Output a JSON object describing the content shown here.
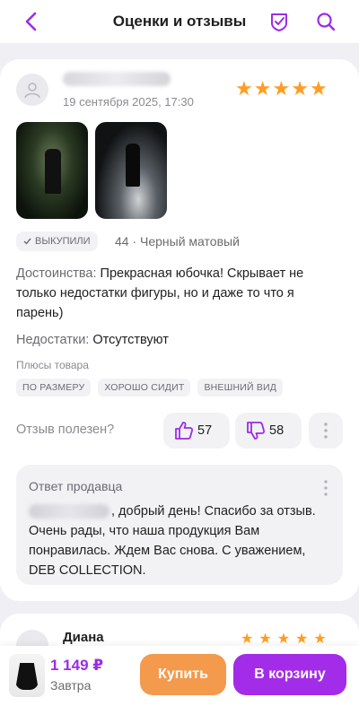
{
  "header": {
    "title": "Оценки и отзывы",
    "back_icon": "chevron-left-icon",
    "check_icon": "shield-check-icon",
    "search_icon": "search-icon",
    "accent": "#9b2ce6"
  },
  "review": {
    "date": "19 сентября 2025, 17:30",
    "rating": 5,
    "rating_max": 5,
    "badge": "ВЫКУПИЛИ",
    "variant": "44 · Черный матовый",
    "pros_label": "Достоинства:",
    "pros_text": "Прекрасная юбочка! Скрывает не только недостатки фигуры, но и даже то что я парень)",
    "cons_label": "Недостатки:",
    "cons_text": "Отсутствуют",
    "pluses_title": "Плюсы товара",
    "tags": [
      "ПО РАЗМЕРУ",
      "ХОРОШО СИДИТ",
      "ВНЕШНИЙ ВИД"
    ],
    "useful_label": "Отзыв полезен?",
    "likes": "57",
    "dislikes": "58",
    "seller_reply": {
      "title": "Ответ продавца",
      "text": ", добрый день! Спасибо за отзыв. Очень рады, что наша продукция Вам понравилась. Ждем Вас снова. С уважением, DEB COLLECTION."
    }
  },
  "next_review": {
    "name": "Диана"
  },
  "bottom_bar": {
    "price": "1 149 ₽",
    "delivery": "Завтра",
    "buy_label": "Купить",
    "cart_label": "В корзину",
    "buy_color": "#f39a4d",
    "cart_color": "#a32ce8"
  }
}
